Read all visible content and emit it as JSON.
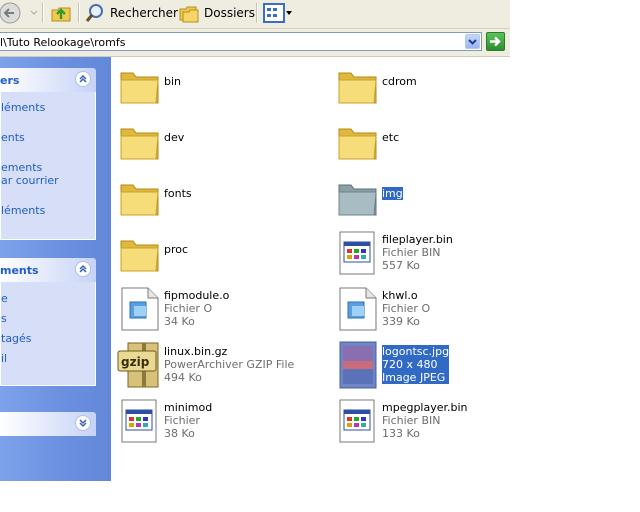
{
  "toolbar": {
    "search_label": "Rechercher",
    "folders_label": "Dossiers"
  },
  "address": {
    "path": "l\\Tuto Relookage\\romfs"
  },
  "taskpane": {
    "panel1": {
      "title": "ers",
      "links": [
        "léments",
        "ents",
        "ements",
        "ar courrier",
        "léments"
      ]
    },
    "panel2": {
      "title": "ments",
      "links": [
        "e",
        "s",
        "tagés",
        "il"
      ]
    }
  },
  "files": [
    {
      "name": "bin",
      "icon": "folder-icon"
    },
    {
      "name": "cdrom",
      "icon": "folder-icon"
    },
    {
      "name": "dev",
      "icon": "folder-icon"
    },
    {
      "name": "etc",
      "icon": "folder-icon"
    },
    {
      "name": "fonts",
      "icon": "folder-icon"
    },
    {
      "name": "img",
      "icon": "folder-icon"
    },
    {
      "name": "proc",
      "icon": "folder-icon"
    },
    {
      "name": "fileplayer.bin",
      "type": "Fichier BIN",
      "size": "557 Ko",
      "icon": "program-file-icon"
    },
    {
      "name": "fipmodule.o",
      "type": "Fichier O",
      "size": "34 Ko",
      "icon": "generic-file-icon"
    },
    {
      "name": "khwl.o",
      "type": "Fichier O",
      "size": "339 Ko",
      "icon": "generic-file-icon"
    },
    {
      "name": "linux.bin.gz",
      "type": "PowerArchiver GZIP File",
      "size": "494 Ko",
      "icon": "gzip-archive-icon"
    },
    {
      "name": "logontsc.jpg",
      "type": "720 x 480",
      "size": "Image JPEG",
      "icon": "jpeg-image-icon"
    },
    {
      "name": "minimod",
      "type": "Fichier",
      "size": "38 Ko",
      "icon": "program-file-icon"
    },
    {
      "name": "mpegplayer.bin",
      "type": "Fichier BIN",
      "size": "133 Ko",
      "icon": "program-file-icon"
    }
  ]
}
